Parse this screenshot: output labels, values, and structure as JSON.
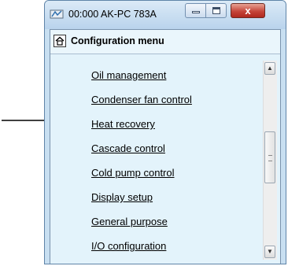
{
  "window": {
    "title": "00:000 AK-PC 783A",
    "icon": "network-device-icon",
    "controls": {
      "minimize": "minimize-icon",
      "maximize": "maximize-icon",
      "close_glyph": "x"
    }
  },
  "menu": {
    "home_icon": "home-icon",
    "title": "Configuration menu",
    "items": [
      {
        "label": "Oil management"
      },
      {
        "label": "Condenser fan control"
      },
      {
        "label": "Heat recovery"
      },
      {
        "label": "Cascade control"
      },
      {
        "label": "Cold pump control"
      },
      {
        "label": "Display setup"
      },
      {
        "label": "General purpose"
      },
      {
        "label": "I/O configuration"
      }
    ]
  },
  "annotation": {
    "pointer": "arrow-right-icon",
    "points_to": "Heat recovery"
  },
  "colors": {
    "window_frame": "#c8dff1",
    "menu_background": "#e3f3fb",
    "close_button": "#c5453a"
  }
}
